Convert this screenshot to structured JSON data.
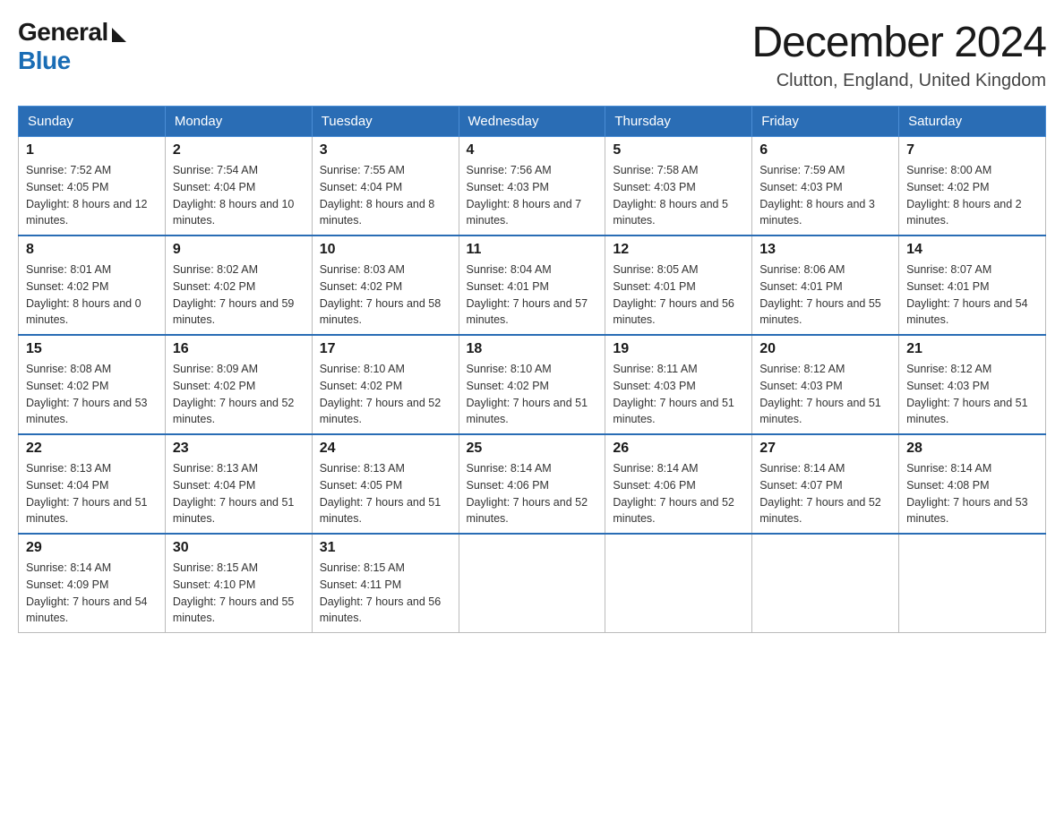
{
  "logo": {
    "general": "General",
    "blue": "Blue"
  },
  "title": "December 2024",
  "location": "Clutton, England, United Kingdom",
  "days_header": [
    "Sunday",
    "Monday",
    "Tuesday",
    "Wednesday",
    "Thursday",
    "Friday",
    "Saturday"
  ],
  "weeks": [
    [
      {
        "day": "1",
        "sunrise": "7:52 AM",
        "sunset": "4:05 PM",
        "daylight": "8 hours and 12 minutes."
      },
      {
        "day": "2",
        "sunrise": "7:54 AM",
        "sunset": "4:04 PM",
        "daylight": "8 hours and 10 minutes."
      },
      {
        "day": "3",
        "sunrise": "7:55 AM",
        "sunset": "4:04 PM",
        "daylight": "8 hours and 8 minutes."
      },
      {
        "day": "4",
        "sunrise": "7:56 AM",
        "sunset": "4:03 PM",
        "daylight": "8 hours and 7 minutes."
      },
      {
        "day": "5",
        "sunrise": "7:58 AM",
        "sunset": "4:03 PM",
        "daylight": "8 hours and 5 minutes."
      },
      {
        "day": "6",
        "sunrise": "7:59 AM",
        "sunset": "4:03 PM",
        "daylight": "8 hours and 3 minutes."
      },
      {
        "day": "7",
        "sunrise": "8:00 AM",
        "sunset": "4:02 PM",
        "daylight": "8 hours and 2 minutes."
      }
    ],
    [
      {
        "day": "8",
        "sunrise": "8:01 AM",
        "sunset": "4:02 PM",
        "daylight": "8 hours and 0 minutes."
      },
      {
        "day": "9",
        "sunrise": "8:02 AM",
        "sunset": "4:02 PM",
        "daylight": "7 hours and 59 minutes."
      },
      {
        "day": "10",
        "sunrise": "8:03 AM",
        "sunset": "4:02 PM",
        "daylight": "7 hours and 58 minutes."
      },
      {
        "day": "11",
        "sunrise": "8:04 AM",
        "sunset": "4:01 PM",
        "daylight": "7 hours and 57 minutes."
      },
      {
        "day": "12",
        "sunrise": "8:05 AM",
        "sunset": "4:01 PM",
        "daylight": "7 hours and 56 minutes."
      },
      {
        "day": "13",
        "sunrise": "8:06 AM",
        "sunset": "4:01 PM",
        "daylight": "7 hours and 55 minutes."
      },
      {
        "day": "14",
        "sunrise": "8:07 AM",
        "sunset": "4:01 PM",
        "daylight": "7 hours and 54 minutes."
      }
    ],
    [
      {
        "day": "15",
        "sunrise": "8:08 AM",
        "sunset": "4:02 PM",
        "daylight": "7 hours and 53 minutes."
      },
      {
        "day": "16",
        "sunrise": "8:09 AM",
        "sunset": "4:02 PM",
        "daylight": "7 hours and 52 minutes."
      },
      {
        "day": "17",
        "sunrise": "8:10 AM",
        "sunset": "4:02 PM",
        "daylight": "7 hours and 52 minutes."
      },
      {
        "day": "18",
        "sunrise": "8:10 AM",
        "sunset": "4:02 PM",
        "daylight": "7 hours and 51 minutes."
      },
      {
        "day": "19",
        "sunrise": "8:11 AM",
        "sunset": "4:03 PM",
        "daylight": "7 hours and 51 minutes."
      },
      {
        "day": "20",
        "sunrise": "8:12 AM",
        "sunset": "4:03 PM",
        "daylight": "7 hours and 51 minutes."
      },
      {
        "day": "21",
        "sunrise": "8:12 AM",
        "sunset": "4:03 PM",
        "daylight": "7 hours and 51 minutes."
      }
    ],
    [
      {
        "day": "22",
        "sunrise": "8:13 AM",
        "sunset": "4:04 PM",
        "daylight": "7 hours and 51 minutes."
      },
      {
        "day": "23",
        "sunrise": "8:13 AM",
        "sunset": "4:04 PM",
        "daylight": "7 hours and 51 minutes."
      },
      {
        "day": "24",
        "sunrise": "8:13 AM",
        "sunset": "4:05 PM",
        "daylight": "7 hours and 51 minutes."
      },
      {
        "day": "25",
        "sunrise": "8:14 AM",
        "sunset": "4:06 PM",
        "daylight": "7 hours and 52 minutes."
      },
      {
        "day": "26",
        "sunrise": "8:14 AM",
        "sunset": "4:06 PM",
        "daylight": "7 hours and 52 minutes."
      },
      {
        "day": "27",
        "sunrise": "8:14 AM",
        "sunset": "4:07 PM",
        "daylight": "7 hours and 52 minutes."
      },
      {
        "day": "28",
        "sunrise": "8:14 AM",
        "sunset": "4:08 PM",
        "daylight": "7 hours and 53 minutes."
      }
    ],
    [
      {
        "day": "29",
        "sunrise": "8:14 AM",
        "sunset": "4:09 PM",
        "daylight": "7 hours and 54 minutes."
      },
      {
        "day": "30",
        "sunrise": "8:15 AM",
        "sunset": "4:10 PM",
        "daylight": "7 hours and 55 minutes."
      },
      {
        "day": "31",
        "sunrise": "8:15 AM",
        "sunset": "4:11 PM",
        "daylight": "7 hours and 56 minutes."
      },
      null,
      null,
      null,
      null
    ]
  ]
}
